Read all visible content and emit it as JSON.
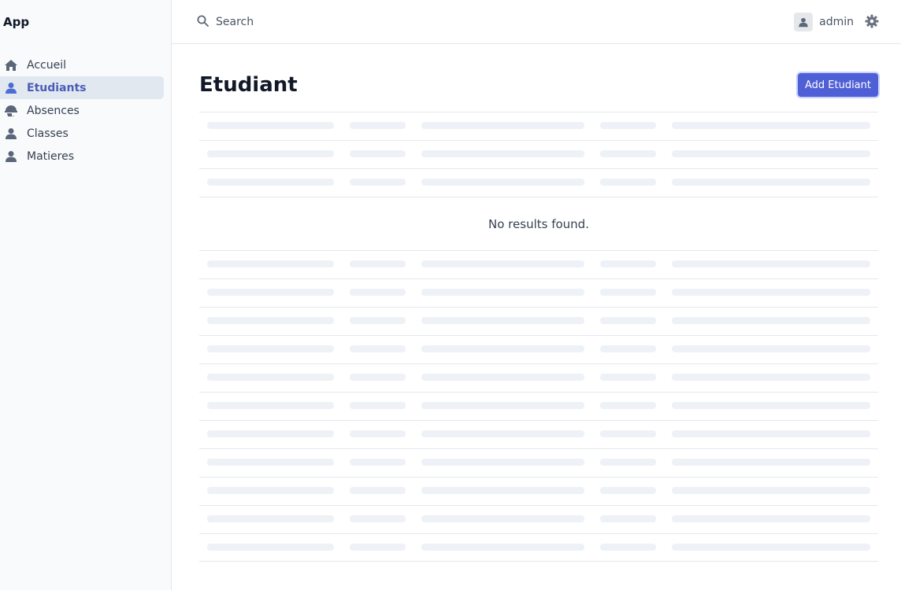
{
  "app": {
    "title": "App"
  },
  "sidebar": {
    "items": [
      {
        "label": "Accueil",
        "icon": "home-icon",
        "active": false
      },
      {
        "label": "Etudiants",
        "icon": "user-icon",
        "active": true
      },
      {
        "label": "Absences",
        "icon": "hat-icon",
        "active": false
      },
      {
        "label": "Classes",
        "icon": "user-icon",
        "active": false
      },
      {
        "label": "Matieres",
        "icon": "user-icon",
        "active": false
      }
    ]
  },
  "header": {
    "search_placeholder": "Search",
    "username": "admin"
  },
  "page": {
    "title": "Etudiant",
    "add_button": "Add Etudiant",
    "empty_message": "No results found."
  },
  "colors": {
    "accent": "#4f5fd6",
    "active_nav_bg": "#e2e8f0",
    "skeleton": "#eef2f7"
  }
}
